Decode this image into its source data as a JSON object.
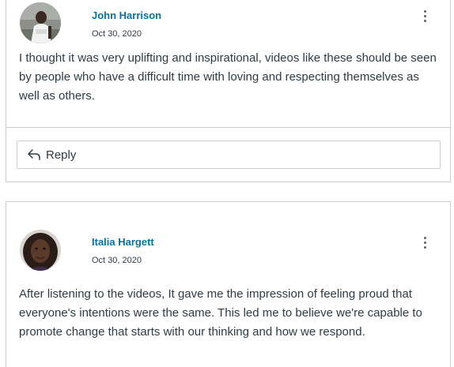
{
  "posts": [
    {
      "author": "John Harrison",
      "date": "Oct 30, 2020",
      "message": "I thought it was very uplifting and inspirational, videos like these should be seen by people who have a difficult time with loving and respecting themselves as well as others.",
      "reply_label": "Reply"
    },
    {
      "author": "Italia Hargett",
      "date": "Oct 30, 2020",
      "message": "After listening to the videos, It gave me the impression of feeling proud that everyone's intentions were the same. This led me to believe we're capable to promote change that starts with our thinking and how we respond."
    }
  ],
  "icons": {
    "options": "kebab-vertical-icon",
    "reply": "reply-arrow-icon"
  },
  "colors": {
    "link": "#0770a3",
    "text": "#2d3b45",
    "border": "#c7cdd1"
  }
}
